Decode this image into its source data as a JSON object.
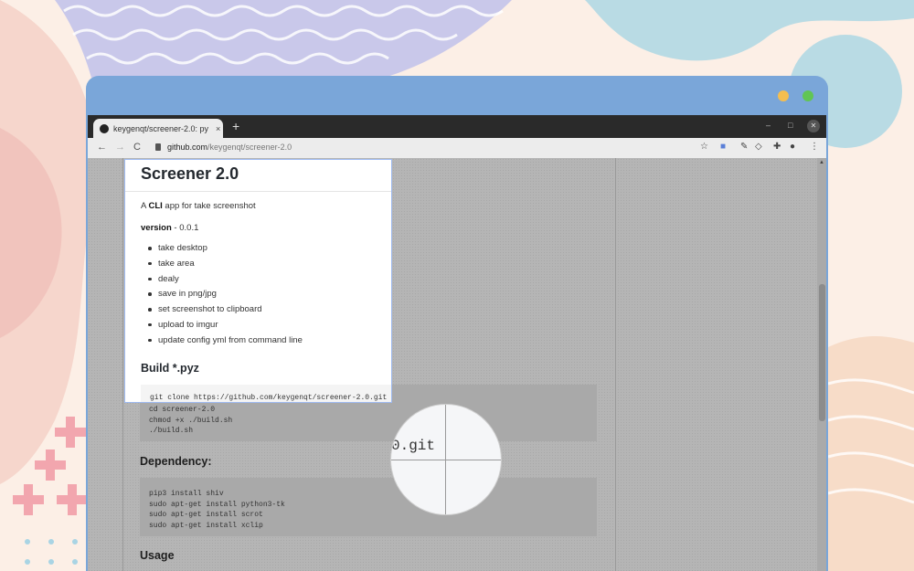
{
  "colors": {
    "background": "#fcefe6",
    "window_frame": "#7aa6d9",
    "traffic_yellow": "#f5be4f",
    "traffic_green": "#61c554",
    "overlay_dim": "#b5b5b5",
    "selection_border": "#9ebaf0"
  },
  "browser": {
    "tab": {
      "title": "keygenqt/screener-2.0: py",
      "close": "×",
      "favicon": "github-icon"
    },
    "new_tab": "+",
    "window_controls": {
      "minimize": "–",
      "maximize": "□",
      "close": "✕"
    },
    "nav": {
      "back": "←",
      "forward": "→",
      "reload": "C"
    },
    "address": {
      "host": "github.com",
      "path": "/keygenqt/screener-2.0"
    },
    "toolbar_icons": [
      "star-icon",
      "translate-icon",
      "extension-icon",
      "shield-icon",
      "puzzle-icon",
      "profile-icon",
      "menu-icon"
    ]
  },
  "readme": {
    "title": "Screener 2.0",
    "description_prefix": "A ",
    "description_bold": "CLI",
    "description_suffix": " app for take screenshot",
    "version_label": "version",
    "version_value": " - 0.0.1",
    "features": [
      "take desktop",
      "take area",
      "dealy",
      "save in png/jpg",
      "set screenshot to clipboard",
      "upload to imgur",
      "update config yml from command line"
    ],
    "build_heading": "Build *.pyz",
    "build_code": [
      "git clone https://github.com/keygenqt/screener-2.0.git",
      "cd screener-2.0",
      "chmod +x ./build.sh",
      "./build.sh"
    ],
    "dependency_heading": "Dependency:",
    "dependency_code": [
      "pip3 install shiv",
      "sudo apt-get install python3-tk",
      "sudo apt-get install scrot",
      "sudo apt-get install xclip"
    ],
    "usage_heading": "Usage"
  },
  "magnifier": {
    "text": "0.git"
  }
}
